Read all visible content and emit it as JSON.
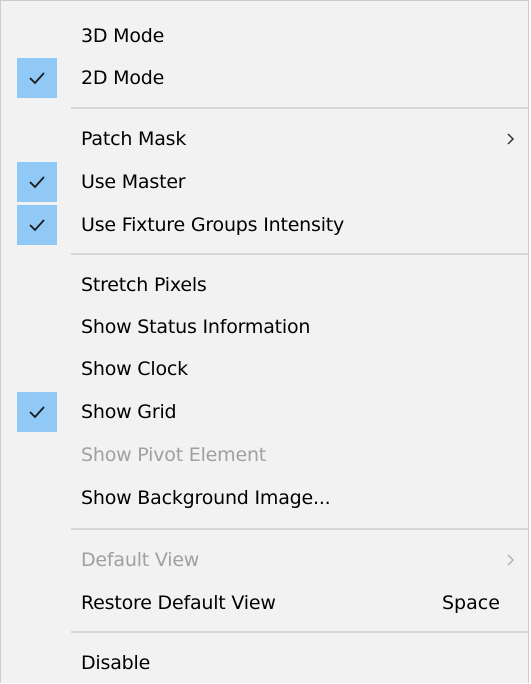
{
  "menu": {
    "items": [
      {
        "label": "3D Mode",
        "checked": false,
        "disabled": false
      },
      {
        "label": "2D Mode",
        "checked": true,
        "disabled": false
      },
      {
        "label": "Patch Mask",
        "checked": false,
        "disabled": false,
        "submenu": true
      },
      {
        "label": "Use Master",
        "checked": true,
        "disabled": false
      },
      {
        "label": "Use Fixture Groups Intensity",
        "checked": true,
        "disabled": false
      },
      {
        "label": "Stretch Pixels",
        "checked": false,
        "disabled": false
      },
      {
        "label": "Show Status Information",
        "checked": false,
        "disabled": false
      },
      {
        "label": "Show Clock",
        "checked": false,
        "disabled": false
      },
      {
        "label": "Show Grid",
        "checked": true,
        "disabled": false
      },
      {
        "label": "Show Pivot Element",
        "checked": false,
        "disabled": true
      },
      {
        "label": "Show Background Image...",
        "checked": false,
        "disabled": false
      },
      {
        "label": "Default View",
        "checked": false,
        "disabled": true,
        "submenu": true
      },
      {
        "label": "Restore Default View",
        "checked": false,
        "disabled": false,
        "shortcut": "Space"
      },
      {
        "label": "Disable",
        "checked": false,
        "disabled": false
      }
    ]
  },
  "colors": {
    "menu_background": "#f2f2f2",
    "check_highlight": "#90c8f6",
    "disabled_text": "#a0a0a0",
    "separator": "#d7d7d7"
  },
  "icons": {
    "check": "checkmark-icon",
    "submenu": "chevron-right-icon"
  }
}
